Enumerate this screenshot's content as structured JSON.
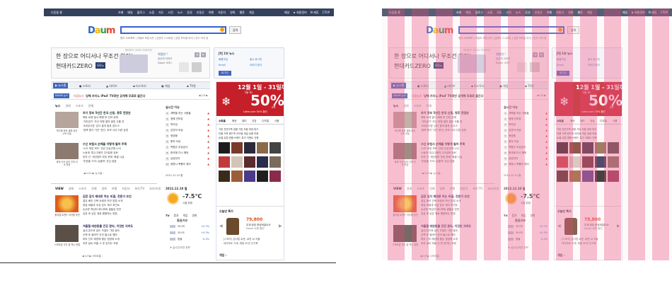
{
  "topbar": {
    "home": "다음을 홈",
    "links": [
      "카페",
      "메일",
      "블로그",
      "쇼핑",
      "지도",
      "사전",
      "뉴스",
      "증권",
      "부동산",
      "여행",
      "자동차",
      "영화",
      "웹툰",
      "게임",
      "웹툰"
    ],
    "right": [
      "메일",
      "★ 회원정보",
      "N 제휴",
      "1TOP",
      "사이트 "
    ]
  },
  "logo": {
    "d": "D",
    "a": "a",
    "u": "u",
    "m": "m"
  },
  "search": {
    "button_label": "검색",
    "related": "원아 소묘폭포 | 이탈토 포튼시즌 | 김연아 스시버튼 | 김영 포도밭 라리 | 인도 아이 등"
  },
  "ad": {
    "line1": "한 장으로 어디서나 무조건 할인!",
    "line2": "현대카드ZERO",
    "zero_btn": "GO ▸",
    "head": "현대카드 ZERO 프로모션",
    "side_title": "위협한 !",
    "side_sub": "당신의 이야기",
    "side_sub2": "Daum 소개 !",
    "arrows": [
      "◀",
      "▶"
    ]
  },
  "login": {
    "title": "JYJ 1위 뉴스",
    "links": [
      "회원가입",
      "동시 로그인",
      "Email",
      "아이디 찾기",
      "로그인"
    ]
  },
  "nav": {
    "tabs": [
      "▶ 뉴스홈",
      "● 스토리",
      "▲ 라이브",
      "▪ 티스토리",
      "▣ 게임",
      "▪ TV팟"
    ]
  },
  "ticker": {
    "badge": "DAUM 뉴스",
    "prefix": "다음뉴스",
    "text": "'상해 카지노 iPad' TV로만 공개해 무료로 즐긴다",
    "pager": "◀ 1/5 ▶"
  },
  "news": {
    "tabs": [
      "뉴스",
      "경제",
      "스포츠",
      "연예"
    ],
    "items": [
      {
        "cap": "박근혜 후보 생애 대선 시작 오늘",
        "h": "차기 정부 5년간 한국 신용, 향후 전망은",
        "lines": [
          "북한 로켓 발사 해명 후 인하 유예",
          "'가라앉기' 초선 의원 결의 발표 사흘 전",
          "'4대강사업' 감사 결과 발표 앞두고",
          "'정책 평가 기관' 문건, 후보 사이 다른 공방"
        ]
      },
      {
        "cap": "세계 각국 금리 인하 지속 전망",
        "h": "수신 보험사 손해율 어떻게 될까 주목",
        "lines": [
          "'노조 파업 보도' 관련 진상규명 나서",
          "노동계 '특수고용직 주5일제 검토'",
          "부처 간 '개인정보 보호 문제' 해결 시급",
          "'투표율 70% 넘을까' 관심 집중"
        ]
      }
    ],
    "pager": "◀ 1/10 ▶  뉴스홈 ›"
  },
  "rank": {
    "title": "실시간 이슈",
    "items": [
      "새벽을 여는 사람들",
      "정혜 진보감",
      "박지성",
      "김연아 의상",
      "정영웅",
      "원칙 이유",
      "박원순 무상급식",
      "한국형 다시 해외",
      "삼성전자",
      "광명시 폭풍우 정리"
    ],
    "foot": "2012.12.10 월"
  },
  "banner": {
    "date": "12월 1일 - 31일까지",
    "sub": "Up to",
    "pct": "50%",
    "off": "off",
    "copy": "Lotte.com 50% 할인"
  },
  "shop": {
    "tabs": [
      "쇼핑홈",
      "패션",
      "뷰티",
      "건강",
      "디지털",
      "식품"
    ],
    "lines": [
      "가방 천연가죽 정품 가방 모음 최대 특가",
      "빈폴 가죽 핸드백 아이템 세일 상품 모음",
      "JK콜 유럽 명품 브랜드 특가 이벤트 진행"
    ]
  },
  "view": {
    "tabs": [
      "VIEW",
      "경제",
      "스포츠",
      "연예",
      "영화",
      "여행",
      "자동차",
      "포토/TV",
      "요리/리빙"
    ],
    "items": [
      {
        "cap": "올겨울 트렌드 아이템 추천",
        "h": "김장 김치 제대로 하는 비결, 전문가 조언",
        "lines": [
          "절임 배추 선택 요령과 보관 방법 소개",
          "양념 비율과 숙성 온도 체크 포인트",
          "손쉬운 백김치 레시피와 곁들임 반찬",
          "김장 후 남은 재료 활용하는 방법"
        ]
      },
      {
        "cap": "스마트폰 사진 잘 찍는 방법",
        "h": "겨울철 애완동물 건강 관리, 이것만 지켜도",
        "lines": [
          "실내 온도와 습도 조절이 가장 중요",
          "산책 후 발바닥 관리 필수로 해야",
          "피부 건조 예방에 좋은 영양제 소개",
          "추운 날씨 외출 시 옷 입히는 요령"
        ]
      }
    ],
    "pager": "◀ 1/3 ▶  VIEW홈 ›"
  },
  "weather": {
    "date": "2012.12.10 월",
    "temp": "-7.5℃",
    "loc": "서울 맑음",
    "tv_tabs": [
      "TV",
      "증권",
      "게임",
      "영화"
    ],
    "head": "증권/지수",
    "rows": [
      {
        "label": "코스피",
        "val": "+0.7%"
      },
      {
        "label": "코스닥",
        "val": "+0.3%"
      },
      {
        "label": "환율",
        "val": "-0.2%"
      }
    ],
    "foot": "※ 실시간/지연 정보"
  },
  "deal": {
    "title": "오늘만 특가",
    "price": "79,800",
    "desc": "무계 정장 한정세일SUF",
    "desc2": "Daum 쇼핑 할인",
    "note1": "[스포츠] 앞다툰 로봇, 로봇 AI 자율",
    "note2": "네이마르 가세, 레알 40년 신기록",
    "arrows": [
      "◀",
      "▶"
    ]
  },
  "game": {
    "title": "게임 ›"
  },
  "colors": {
    "topbar": "#33415c",
    "accent": "#3a5fd0",
    "banner": "#c51f2a",
    "stripe": "#e94678"
  }
}
